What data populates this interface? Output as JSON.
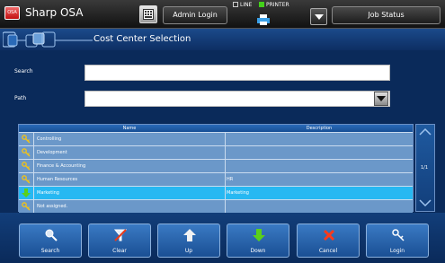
{
  "header": {
    "logo_text": "OSA",
    "app_title": "Sharp OSA",
    "admin_login": "Admin Login",
    "line_label": "LINE",
    "printer_label": "PRINTER",
    "job_status": "Job Status"
  },
  "title": "Cost Center Selection",
  "form": {
    "search_label": "Search",
    "search_value": "",
    "path_label": "Path",
    "path_value": ""
  },
  "table": {
    "columns": [
      "Name",
      "Description"
    ],
    "rows": [
      {
        "name": "Controlling",
        "description": "",
        "icon": "key-icon",
        "selected": false
      },
      {
        "name": "Development",
        "description": "",
        "icon": "key-icon",
        "selected": false
      },
      {
        "name": "Finance & Accounting",
        "description": "",
        "icon": "key-icon",
        "selected": false
      },
      {
        "name": "Human Resources",
        "description": "HR",
        "icon": "key-icon",
        "selected": false
      },
      {
        "name": "Marketing",
        "description": "Marketing",
        "icon": "down-arrow-icon",
        "selected": true
      },
      {
        "name": "Not assigned.",
        "description": "",
        "icon": "key-icon",
        "selected": false
      }
    ],
    "page": "1/1"
  },
  "buttons": {
    "search": "Search",
    "clear": "Clear",
    "up": "Up",
    "down": "Down",
    "cancel": "Cancel",
    "login": "Login"
  },
  "colors": {
    "background": "#0a2a5a",
    "row": "#6b98c9",
    "row_selected": "#27b8f2",
    "accent_green": "#43d01a"
  }
}
